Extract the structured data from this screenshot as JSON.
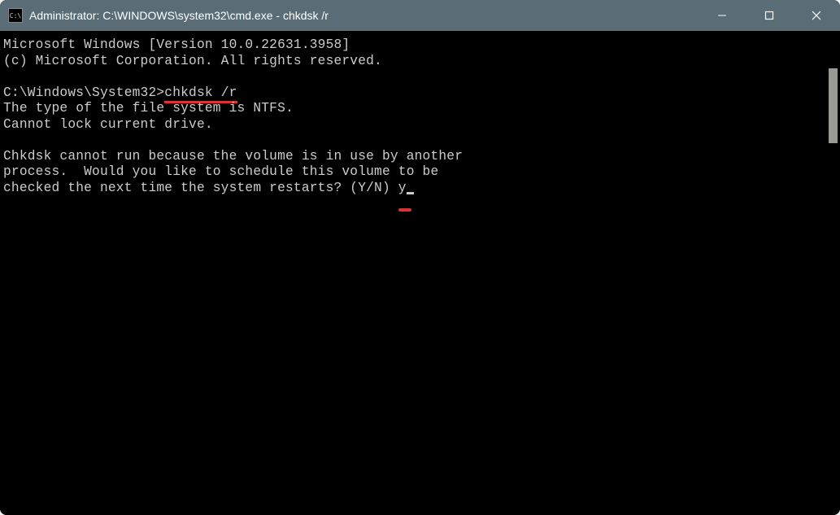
{
  "titlebar": {
    "icon_text": "C:\\",
    "title": "Administrator: C:\\WINDOWS\\system32\\cmd.exe - chkdsk  /r"
  },
  "terminal": {
    "line1": "Microsoft Windows [Version 10.0.22631.3958]",
    "line2": "(c) Microsoft Corporation. All rights reserved.",
    "line3_prompt": "C:\\Windows\\System32>",
    "line3_cmd": "chkdsk /r",
    "line4": "The type of the file system is NTFS.",
    "line5": "Cannot lock current drive.",
    "line6": "Chkdsk cannot run because the volume is in use by another",
    "line7": "process.  Would you like to schedule this volume to be",
    "line8_a": "checked the next time the system restarts? (Y/N) ",
    "line8_b": "y"
  }
}
